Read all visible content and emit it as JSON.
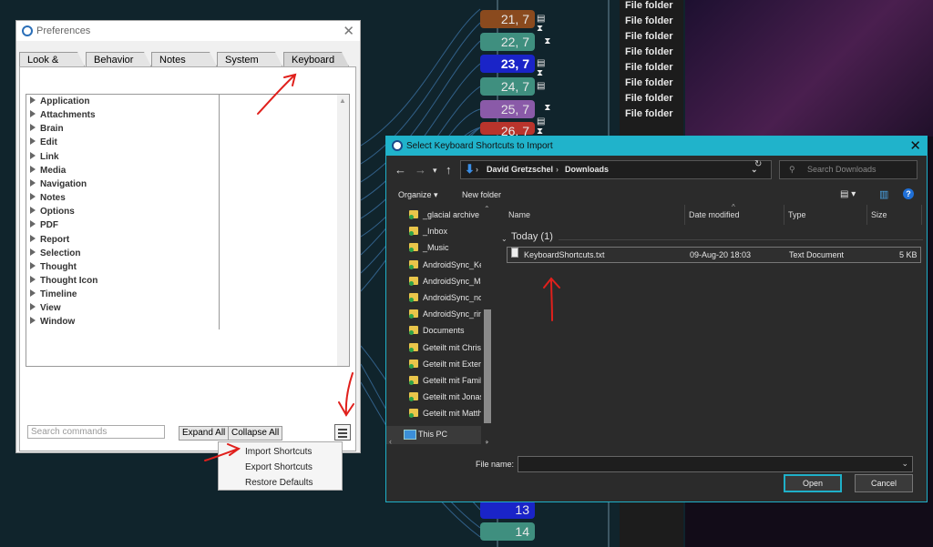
{
  "background": {
    "nodes": [
      {
        "label": "21, 7",
        "color": "#8a4a1e"
      },
      {
        "label": "22, 7",
        "color": "#3f8f7f"
      },
      {
        "label": "23, 7",
        "color": "#1a24c8"
      },
      {
        "label": "24, 7",
        "color": "#3f8f7f"
      },
      {
        "label": "25, 7",
        "color": "#8a5aa8"
      },
      {
        "label": "26, 7",
        "color": "#b8342c"
      },
      {
        "label": "13",
        "color": "#1a24c8"
      },
      {
        "label": "14",
        "color": "#3f8f7f"
      }
    ],
    "file_folder_label": "File folder",
    "file_folder_count": 8
  },
  "preferences": {
    "title": "Preferences",
    "tabs": [
      "Look & Feel",
      "Behavior",
      "Notes Editor",
      "System",
      "Keyboard"
    ],
    "active_tab": "Keyboard",
    "categories": [
      "Application",
      "Attachments",
      "Brain",
      "Edit",
      "Link",
      "Media",
      "Navigation",
      "Notes",
      "Options",
      "PDF",
      "Report",
      "Selection",
      "Thought",
      "Thought Icon",
      "Timeline",
      "View",
      "Window"
    ],
    "search_placeholder": "Search commands",
    "expand_all": "Expand All",
    "collapse_all": "Collapse All"
  },
  "context_menu": {
    "items": [
      "Import Shortcuts",
      "Export Shortcuts",
      "Restore Defaults"
    ]
  },
  "file_dialog": {
    "title": "Select Keyboard Shortcuts to Import",
    "path": [
      "David Gretzschel",
      "Downloads"
    ],
    "search_placeholder": "Search Downloads",
    "organize": "Organize ▾",
    "new_folder": "New folder",
    "nav_items": [
      "_glacial archive",
      "_Inbox",
      "_Music",
      "AndroidSync_Ke",
      "AndroidSync_Ma",
      "AndroidSync_no",
      "AndroidSync_rin",
      "Documents",
      "Geteilt mit Chris",
      "Geteilt mit Extern",
      "Geteilt mit Famil",
      "Geteilt mit Jonas",
      "Geteilt mit Matth"
    ],
    "this_pc": "This PC",
    "columns": {
      "name": "Name",
      "date": "Date modified",
      "type": "Type",
      "size": "Size"
    },
    "group": "Today (1)",
    "file": {
      "name": "KeyboardShortcuts.txt",
      "date": "09-Aug-20 18:03",
      "type": "Text Document",
      "size": "5 KB"
    },
    "file_name_label": "File name:",
    "open": "Open",
    "cancel": "Cancel"
  }
}
